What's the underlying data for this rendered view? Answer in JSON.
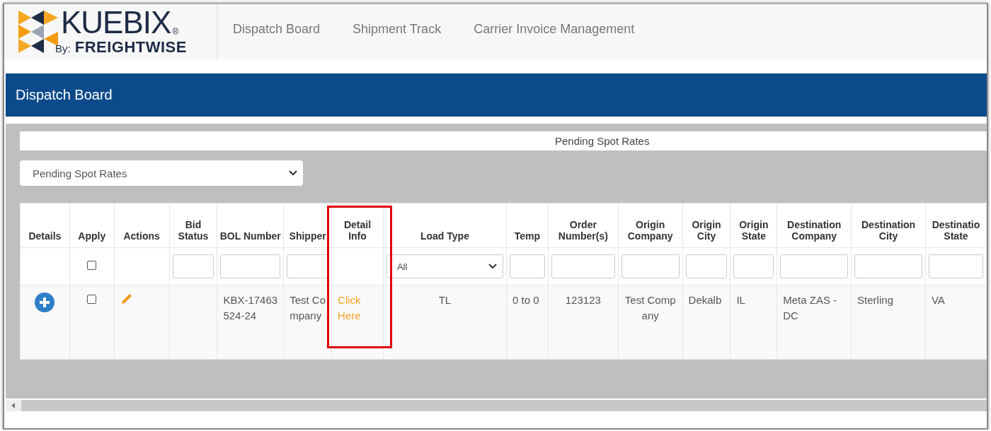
{
  "logo": {
    "name": "KUEBIX",
    "mark": "®",
    "by": "By:",
    "company": "FREIGHTWISE"
  },
  "nav": [
    {
      "label": "Dispatch Board"
    },
    {
      "label": "Shipment Track"
    },
    {
      "label": "Carrier Invoice Management"
    }
  ],
  "banner": {
    "title": "Dispatch Board"
  },
  "view_title": "Pending Spot Rates",
  "view_select": {
    "value": "Pending Spot Rates"
  },
  "table": {
    "columns": [
      {
        "label": "Details",
        "highlighted": false
      },
      {
        "label": "Apply",
        "highlighted": false
      },
      {
        "label": "Actions",
        "highlighted": false
      },
      {
        "label": "Bid Status",
        "highlighted": false
      },
      {
        "label": "BOL Number",
        "highlighted": false
      },
      {
        "label": "Shipper",
        "highlighted": false
      },
      {
        "label": "Detail Info",
        "highlighted": true
      },
      {
        "label": "Load Type",
        "highlighted": false
      },
      {
        "label": "Temp",
        "highlighted": false
      },
      {
        "label": "Order Number(s)",
        "highlighted": false
      },
      {
        "label": "Origin Company",
        "highlighted": false
      },
      {
        "label": "Origin City",
        "highlighted": false
      },
      {
        "label": "Origin State",
        "highlighted": false
      },
      {
        "label": "Destination Company",
        "highlighted": false
      },
      {
        "label": "Destination City",
        "highlighted": false
      },
      {
        "label": "Destinatio State",
        "highlighted": false
      }
    ],
    "filters": [
      {
        "kind": "none"
      },
      {
        "kind": "checkbox",
        "checked": false
      },
      {
        "kind": "none"
      },
      {
        "kind": "input"
      },
      {
        "kind": "input"
      },
      {
        "kind": "input"
      },
      {
        "kind": "none"
      },
      {
        "kind": "select",
        "value": "All"
      },
      {
        "kind": "input"
      },
      {
        "kind": "input"
      },
      {
        "kind": "input"
      },
      {
        "kind": "input"
      },
      {
        "kind": "input"
      },
      {
        "kind": "input"
      },
      {
        "kind": "input"
      },
      {
        "kind": "input"
      }
    ],
    "rows": [
      {
        "cells": [
          {
            "kind": "expand"
          },
          {
            "kind": "checkbox",
            "checked": false
          },
          {
            "kind": "edit"
          },
          {
            "kind": "empty"
          },
          {
            "kind": "text",
            "text": "KBX-17463524-24"
          },
          {
            "kind": "text",
            "text": "Test Company"
          },
          {
            "kind": "link",
            "text": "Click Here"
          },
          {
            "kind": "text",
            "text": "TL"
          },
          {
            "kind": "text",
            "text": "0 to 0"
          },
          {
            "kind": "text",
            "text": "123123"
          },
          {
            "kind": "text",
            "text": "Test Company"
          },
          {
            "kind": "text",
            "text": "Dekalb"
          },
          {
            "kind": "text",
            "text": "IL"
          },
          {
            "kind": "text",
            "text": "Meta ZAS - DC"
          },
          {
            "kind": "text",
            "text": "Sterling"
          },
          {
            "kind": "text",
            "text": "VA"
          }
        ]
      }
    ]
  }
}
